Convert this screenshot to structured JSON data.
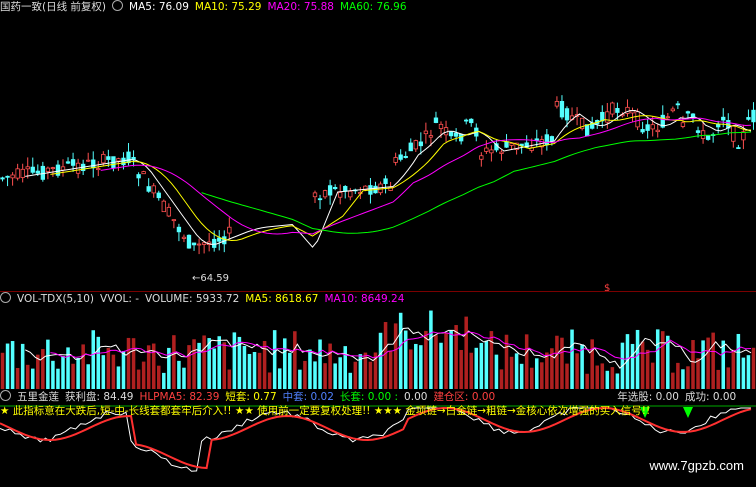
{
  "header": {
    "stock": "国药一致(日线 前复权)",
    "ma5": "MA5: 76.09",
    "ma10": "MA10: 75.29",
    "ma20": "MA20: 75.88",
    "ma60": "MA60: 76.96"
  },
  "price_panel": {
    "low_label": "←64.59",
    "marker": "$"
  },
  "volume_header": {
    "name": "VOL-TDX(5,10)",
    "vvol": "VVOL: -",
    "volume": "VOLUME: 5933.72",
    "ma5": "MA5: 8618.67",
    "ma10": "MA10: 8649.24"
  },
  "indicator_header": {
    "name": "五里金莲",
    "profit": "获利盘: 84.49",
    "hlpma5": "HLPMA5: 82.39",
    "short": "短套: 0.77",
    "mid": "中套: 0.02",
    "long": "长套: 0.00 :",
    "mid2": "0.00",
    "build": "建仓区: 0.00",
    "pick": "年选股: 0.00",
    "success": "成功: 0.00"
  },
  "scroll_text": "★ 此指标意在大跌后,短-中-长线套都套牢后介入!! ★★ 使用前一定要复权处理!! ★★★ 金项链→白金链→粗链→金核心依次增强的买入信号!!",
  "watermark": "www.7gpzb.com",
  "colors": {
    "up": "#ff5050",
    "down": "#54ffff",
    "ma5": "#ffffff",
    "ma10": "#ffff00",
    "ma20": "#ff00ff",
    "ma60": "#00ff00"
  }
}
